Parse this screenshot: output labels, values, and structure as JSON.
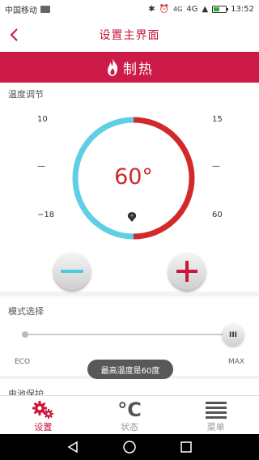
{
  "status_bar": {
    "carrier": "中国移动",
    "network": "4G",
    "network_small": "4G",
    "time": "13:52"
  },
  "header": {
    "title": "设置主界面"
  },
  "mode_banner": {
    "label": "制热",
    "color": "#cc1b49"
  },
  "temperature": {
    "section_title": "温度调节",
    "value_display": "60°",
    "setpoint": 60,
    "scale_top_left": "10",
    "scale_mid_left": "—",
    "scale_bottom_left": "−18",
    "scale_top_right": "15",
    "scale_mid_right": "—",
    "scale_bottom_right": "60",
    "cold_color": "#5fcfe6",
    "hot_color": "#d22a2a"
  },
  "mode_select": {
    "section_title": "模式选择",
    "min_label": "ECO",
    "max_label": "MAX",
    "slider_level": 1.0
  },
  "toast": {
    "text": "最高温度是60度"
  },
  "next_section": {
    "title": "电池保护"
  },
  "tabs": [
    {
      "label": "设置",
      "icon": "gears-icon",
      "active": true
    },
    {
      "label": "状态",
      "icon": "celsius-icon",
      "active": false
    },
    {
      "label": "菜单",
      "icon": "menu-icon",
      "active": false
    }
  ]
}
